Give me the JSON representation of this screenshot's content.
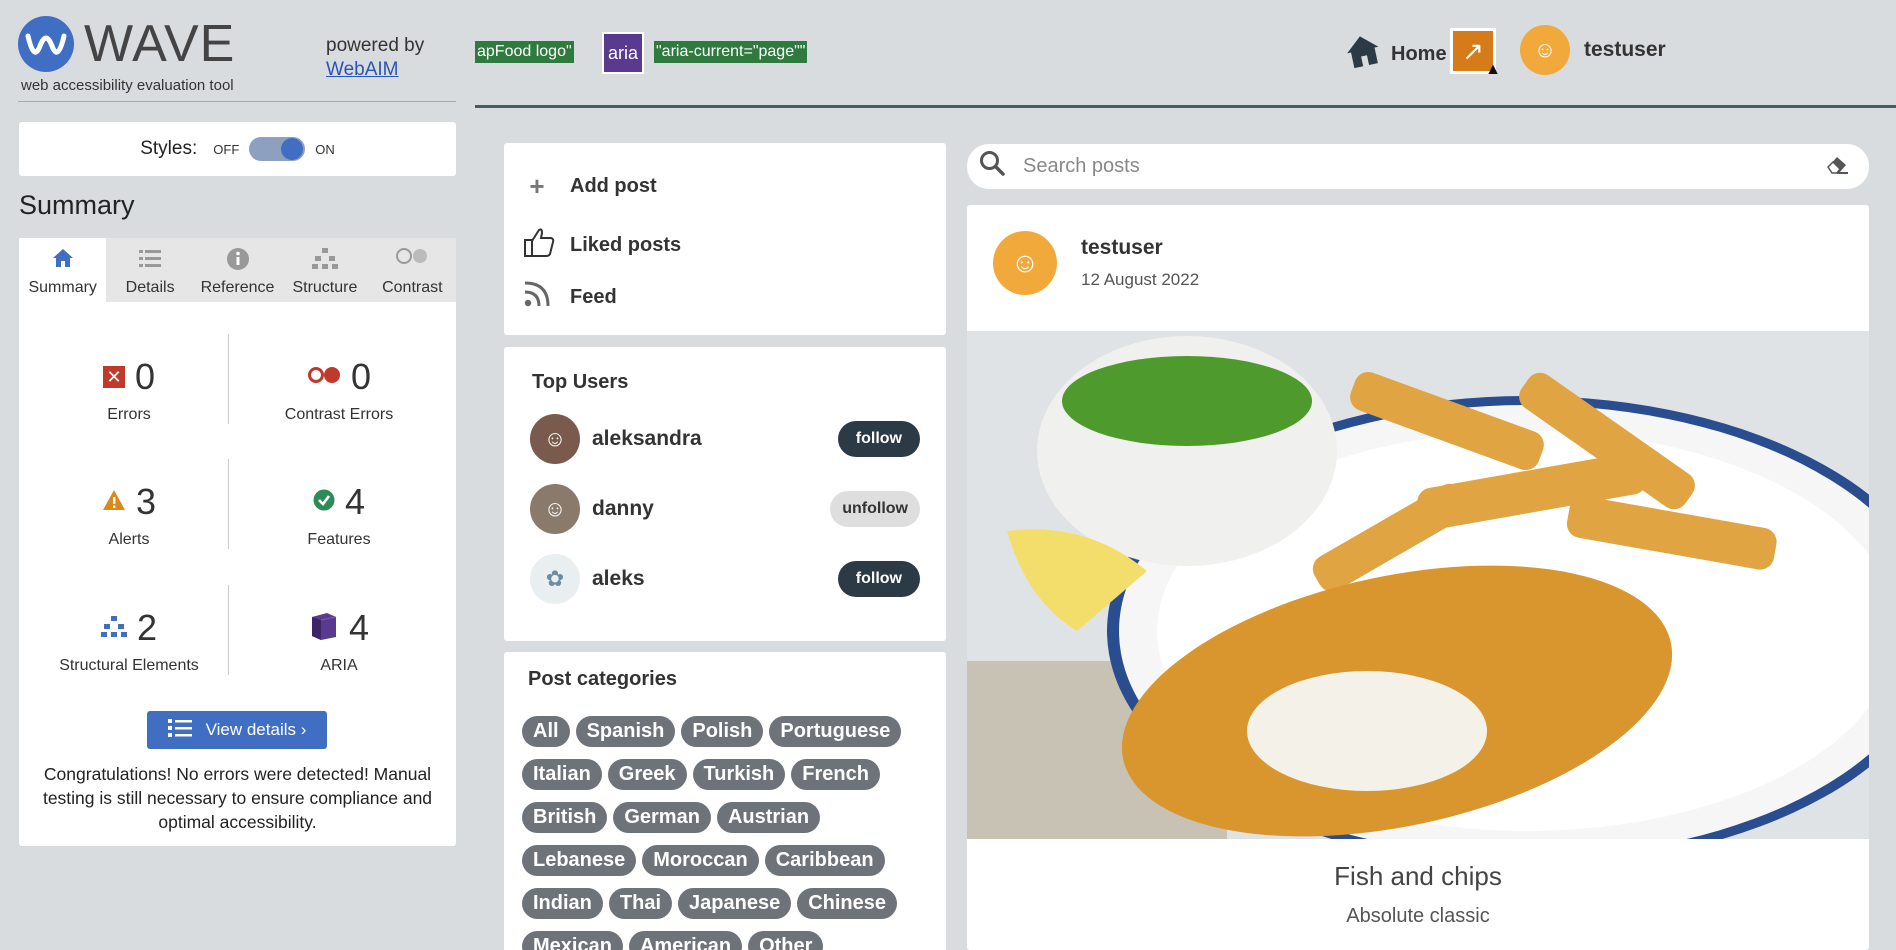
{
  "wave": {
    "logo_letter": "W",
    "brand": "WAVE",
    "tagline": "web accessibility evaluation tool",
    "powered_by": "powered by",
    "powered_link": "WebAIM",
    "styles_label": "Styles:",
    "styles_off": "OFF",
    "styles_on": "ON",
    "summary_title": "Summary",
    "tabs": [
      {
        "label": "Summary",
        "icon": "home-icon",
        "active": true
      },
      {
        "label": "Details",
        "icon": "list-icon"
      },
      {
        "label": "Reference",
        "icon": "info-icon"
      },
      {
        "label": "Structure",
        "icon": "structure-icon"
      },
      {
        "label": "Contrast",
        "icon": "contrast-icon"
      }
    ],
    "stats": {
      "errors": {
        "count": "0",
        "label": "Errors"
      },
      "contrast_errors": {
        "count": "0",
        "label": "Contrast Errors"
      },
      "alerts": {
        "count": "3",
        "label": "Alerts"
      },
      "features": {
        "count": "4",
        "label": "Features"
      },
      "structural": {
        "count": "2",
        "label": "Structural Elements"
      },
      "aria": {
        "count": "4",
        "label": "ARIA"
      }
    },
    "view_details": "View details ›",
    "congrats": "Congratulations! No errors were detected! Manual testing is still necessary to ensure compliance and optimal accessibility."
  },
  "header": {
    "tag1": "apFood logo\"",
    "aria_badge": "aria",
    "tag2": "\"aria-current=\"page\"\"",
    "home": "Home",
    "username": "testuser"
  },
  "menu": {
    "add_post": "Add post",
    "liked_posts": "Liked posts",
    "feed": "Feed"
  },
  "top_users": {
    "title": "Top Users",
    "users": [
      {
        "name": "aleksandra",
        "action": "follow"
      },
      {
        "name": "danny",
        "action": "unfollow"
      },
      {
        "name": "aleks",
        "action": "follow"
      }
    ]
  },
  "categories": {
    "title": "Post categories",
    "items": [
      "All",
      "Spanish",
      "Polish",
      "Portuguese",
      "Italian",
      "Greek",
      "Turkish",
      "French",
      "British",
      "German",
      "Austrian",
      "Lebanese",
      "Moroccan",
      "Caribbean",
      "Indian",
      "Thai",
      "Japanese",
      "Chinese",
      "Mexican",
      "American",
      "Other"
    ]
  },
  "search": {
    "placeholder": "Search posts"
  },
  "post": {
    "author": "testuser",
    "date": "12 August 2022",
    "title": "Fish and chips",
    "subtitle": "Absolute classic"
  },
  "colors": {
    "wave_blue": "#3f6ec2",
    "chip": "#6d7379",
    "follow_btn": "#2b3a45"
  }
}
